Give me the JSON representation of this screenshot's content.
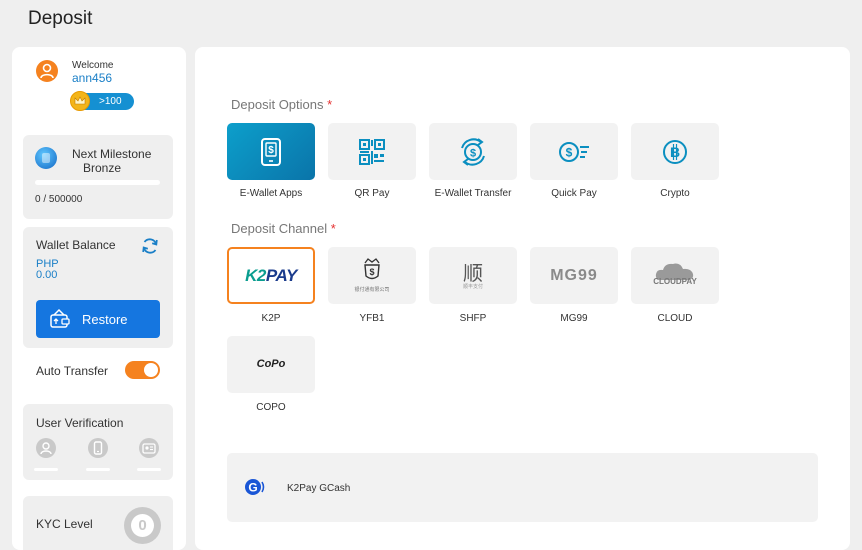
{
  "page": {
    "title": "Deposit"
  },
  "sidebar": {
    "welcome_label": "Welcome",
    "username": "ann456",
    "vip_text": ">100",
    "milestone": {
      "title": "Next Milestone",
      "level": "Bronze",
      "progress_text": "0 / 500000",
      "progress_fraction": 0
    },
    "wallet": {
      "title": "Wallet Balance",
      "currency": "PHP",
      "amount": "0.00",
      "restore_label": "Restore"
    },
    "auto_transfer": {
      "label": "Auto Transfer",
      "enabled": true
    },
    "verification": {
      "title": "User Verification",
      "icons": [
        "user-icon",
        "phone-icon",
        "id-card-icon"
      ]
    },
    "kyc": {
      "title": "KYC Level",
      "level": "0"
    }
  },
  "main": {
    "deposit_options": {
      "label": "Deposit Options",
      "required_mark": "*",
      "selected": "E-Wallet Apps",
      "items": [
        {
          "label": "E-Wallet Apps",
          "icon": "mobile-wallet-icon"
        },
        {
          "label": "QR Pay",
          "icon": "qr-code-icon"
        },
        {
          "label": "E-Wallet Transfer",
          "icon": "transfer-icon"
        },
        {
          "label": "Quick Pay",
          "icon": "quick-pay-icon"
        },
        {
          "label": "Crypto",
          "icon": "bitcoin-icon"
        }
      ]
    },
    "deposit_channel": {
      "label": "Deposit Channel",
      "required_mark": "*",
      "selected": "K2P",
      "items": [
        {
          "label": "K2P",
          "logo_text_a": "K2",
          "logo_text_b": "PAY"
        },
        {
          "label": "YFB1",
          "logo_sub": "银付通有限公司"
        },
        {
          "label": "SHFP",
          "logo_text": "顺",
          "logo_sub": "顺丰支付"
        },
        {
          "label": "MG99",
          "logo_text": "MG99"
        },
        {
          "label": "CLOUD",
          "logo_text": "CLOUDPAY"
        },
        {
          "label": "COPO",
          "logo_text": "CoPo"
        }
      ]
    },
    "gateway": {
      "label": "K2Pay GCash",
      "icon": "gcash-icon"
    }
  },
  "colors": {
    "accent_orange": "#f5821f",
    "accent_blue": "#1576e0",
    "link_blue": "#1a7fc7",
    "tile_active": "#0d9fcb"
  }
}
